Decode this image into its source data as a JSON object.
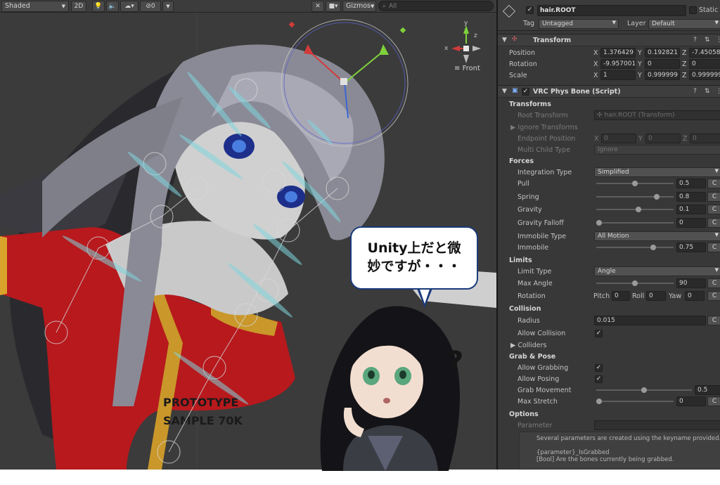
{
  "scene_view": {
    "shading_mode": "Shaded",
    "mode_2d": "2D",
    "fx_count": "0",
    "gizmos_label": "Gizmos",
    "search_placeholder": "All",
    "axes": {
      "x": "x",
      "y": "y",
      "z": "z"
    },
    "view_label": "Front",
    "model_text": {
      "line1": "PROTOTYPE",
      "line2": "SAMPLE 70K"
    }
  },
  "speech_bubble": {
    "line1": "Unity上だと微",
    "line2": "妙ですが・・・"
  },
  "inspector": {
    "object_name": "hair.ROOT",
    "static_label": "Static",
    "tag_label": "Tag",
    "tag_value": "Untagged",
    "layer_label": "Layer",
    "layer_value": "Default",
    "transform": {
      "title": "Transform",
      "position_label": "Position",
      "rotation_label": "Rotation",
      "scale_label": "Scale",
      "position": {
        "x": "1.376429",
        "y": "0.192821",
        "z": "-7.45058"
      },
      "rotation": {
        "x": "-9.957001",
        "y": "0",
        "z": "0"
      },
      "scale": {
        "x": "1",
        "y": "0.999999",
        "z": "0.999999"
      }
    },
    "physbone": {
      "title": "VRC Phys Bone (Script)",
      "sections": {
        "transforms": "Transforms",
        "forces": "Forces",
        "limits": "Limits",
        "collision": "Collision",
        "grab_pose": "Grab & Pose",
        "options": "Options"
      },
      "root_transform": {
        "label": "Root Transform",
        "value": "hair.ROOT (Transform)"
      },
      "ignore_transforms": "Ignore Transforms",
      "endpoint_position": {
        "label": "Endpoint Position",
        "x": "0",
        "y": "0",
        "z": "0"
      },
      "multi_child_type": {
        "label": "Multi Child Type",
        "value": "Ignore"
      },
      "integration_type": {
        "label": "Integration Type",
        "value": "Simplified"
      },
      "pull": {
        "label": "Pull",
        "value": "0.5",
        "fraction": 0.5
      },
      "spring": {
        "label": "Spring",
        "value": "0.8",
        "fraction": 0.8
      },
      "gravity": {
        "label": "Gravity",
        "value": "0.1",
        "fraction": 0.55
      },
      "gravity_falloff": {
        "label": "Gravity Falloff",
        "value": "0",
        "fraction": 0.0
      },
      "immobile_type": {
        "label": "Immobile Type",
        "value": "All Motion"
      },
      "immobile": {
        "label": "Immobile",
        "value": "0.75",
        "fraction": 0.75
      },
      "limit_type": {
        "label": "Limit Type",
        "value": "Angle"
      },
      "max_angle": {
        "label": "Max Angle",
        "value": "90",
        "fraction": 0.5
      },
      "limit_rotation": {
        "label": "Rotation",
        "pitch_label": "Pitch",
        "pitch": "0",
        "roll_label": "Roll",
        "roll": "0",
        "yaw_label": "Yaw",
        "yaw": "0"
      },
      "radius": {
        "label": "Radius",
        "value": "0.015"
      },
      "allow_collision": {
        "label": "Allow Collision",
        "checked": "✓"
      },
      "colliders": "Colliders",
      "allow_grabbing": {
        "label": "Allow Grabbing",
        "checked": "✓"
      },
      "allow_posing": {
        "label": "Allow Posing",
        "checked": "✓"
      },
      "grab_movement": {
        "label": "Grab Movement",
        "value": "0.5",
        "fraction": 0.5
      },
      "max_stretch": {
        "label": "Max Stretch",
        "value": "0",
        "fraction": 0.0
      },
      "parameter": {
        "label": "Parameter",
        "value": ""
      },
      "help_text": "Several parameters are created using the keyname provided.",
      "help_param_name": "{parameter}_IsGrabbed",
      "help_param_desc": "[Bool] Are the bones currently being grabbed.",
      "c_label": "C"
    }
  }
}
